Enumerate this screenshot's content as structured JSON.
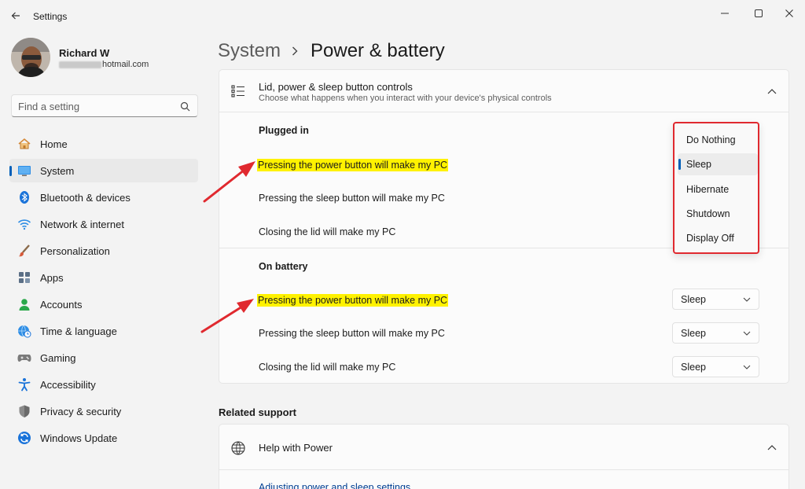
{
  "window": {
    "title": "Settings",
    "back_icon": "arrow-left-icon",
    "controls": [
      "minimize-icon",
      "maximize-icon",
      "close-icon"
    ]
  },
  "profile": {
    "name": "Richard W",
    "email_domain": "hotmail.com"
  },
  "search": {
    "placeholder": "Find a setting"
  },
  "nav": {
    "items": [
      {
        "label": "Home",
        "icon": "home-icon",
        "active": false
      },
      {
        "label": "System",
        "icon": "system-icon",
        "active": true
      },
      {
        "label": "Bluetooth & devices",
        "icon": "bluetooth-icon",
        "active": false
      },
      {
        "label": "Network & internet",
        "icon": "wifi-icon",
        "active": false
      },
      {
        "label": "Personalization",
        "icon": "brush-icon",
        "active": false
      },
      {
        "label": "Apps",
        "icon": "apps-icon",
        "active": false
      },
      {
        "label": "Accounts",
        "icon": "accounts-icon",
        "active": false
      },
      {
        "label": "Time & language",
        "icon": "globe-clock-icon",
        "active": false
      },
      {
        "label": "Gaming",
        "icon": "gamepad-icon",
        "active": false
      },
      {
        "label": "Accessibility",
        "icon": "accessibility-icon",
        "active": false
      },
      {
        "label": "Privacy & security",
        "icon": "shield-icon",
        "active": false
      },
      {
        "label": "Windows Update",
        "icon": "update-icon",
        "active": false
      }
    ]
  },
  "breadcrumb": {
    "parent": "System",
    "current": "Power & battery"
  },
  "lid_expander": {
    "title": "Lid, power & sleep button controls",
    "subtitle": "Choose what happens when you interact with your device's physical controls",
    "plugged_in": {
      "label": "Plugged in",
      "power_button": "Pressing the power button will make my PC",
      "sleep_button": "Pressing the sleep button will make my PC",
      "lid": "Closing the lid will make my PC"
    },
    "on_battery": {
      "label": "On battery",
      "power_button": "Pressing the power button will make my PC",
      "power_value": "Sleep",
      "sleep_button": "Pressing the sleep button will make my PC",
      "sleep_value": "Sleep",
      "lid": "Closing the lid will make my PC",
      "lid_value": "Sleep"
    }
  },
  "popup": {
    "options": [
      "Do Nothing",
      "Sleep",
      "Hibernate",
      "Shutdown",
      "Display Off"
    ],
    "selected": "Sleep"
  },
  "related_support": {
    "title": "Related support",
    "help_title": "Help with Power",
    "link": "Adjusting power and sleep settings"
  },
  "colors": {
    "accent": "#005fb8",
    "highlight": "#fff200",
    "annotation_red": "#e0292f"
  }
}
